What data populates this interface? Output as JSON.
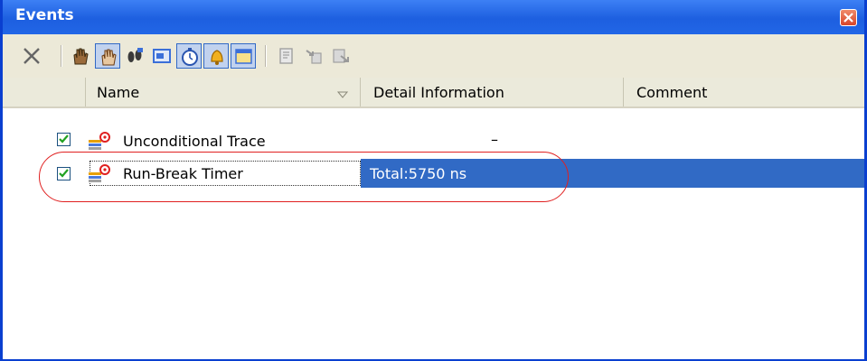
{
  "window": {
    "title": "Events"
  },
  "toolbar": {
    "buttons": [
      {
        "name": "delete",
        "icon": "delete-x-icon",
        "pressed": false
      },
      {
        "name": "hardware-break",
        "icon": "hand-icon",
        "pressed": false
      },
      {
        "name": "software-break",
        "icon": "hand-icon",
        "pressed": true
      },
      {
        "name": "trace",
        "icon": "footprints-icon",
        "pressed": false
      },
      {
        "name": "timer",
        "icon": "stopwatch-icon",
        "pressed": true
      },
      {
        "name": "action",
        "icon": "bell-icon",
        "pressed": true
      },
      {
        "name": "other",
        "icon": "window-icon",
        "pressed": true
      },
      {
        "name": "edit-condition",
        "icon": "document-icon",
        "pressed": false
      },
      {
        "name": "import",
        "icon": "import-icon",
        "pressed": false
      },
      {
        "name": "export",
        "icon": "export-icon",
        "pressed": false
      }
    ]
  },
  "columns": {
    "name": "Name",
    "detail": "Detail Information",
    "comment": "Comment"
  },
  "rows": [
    {
      "checked": true,
      "icon": "trace-event-icon",
      "name": "Unconditional Trace",
      "detail": "–",
      "comment": ""
    },
    {
      "checked": true,
      "icon": "timer-event-icon",
      "name": "Run-Break Timer",
      "detail": "Total:5750 ns",
      "comment": "",
      "selected": true
    }
  ],
  "colors": {
    "titlebar": "#1d5fe0",
    "selection": "#316ac5",
    "highlight_ring": "#e02020"
  }
}
